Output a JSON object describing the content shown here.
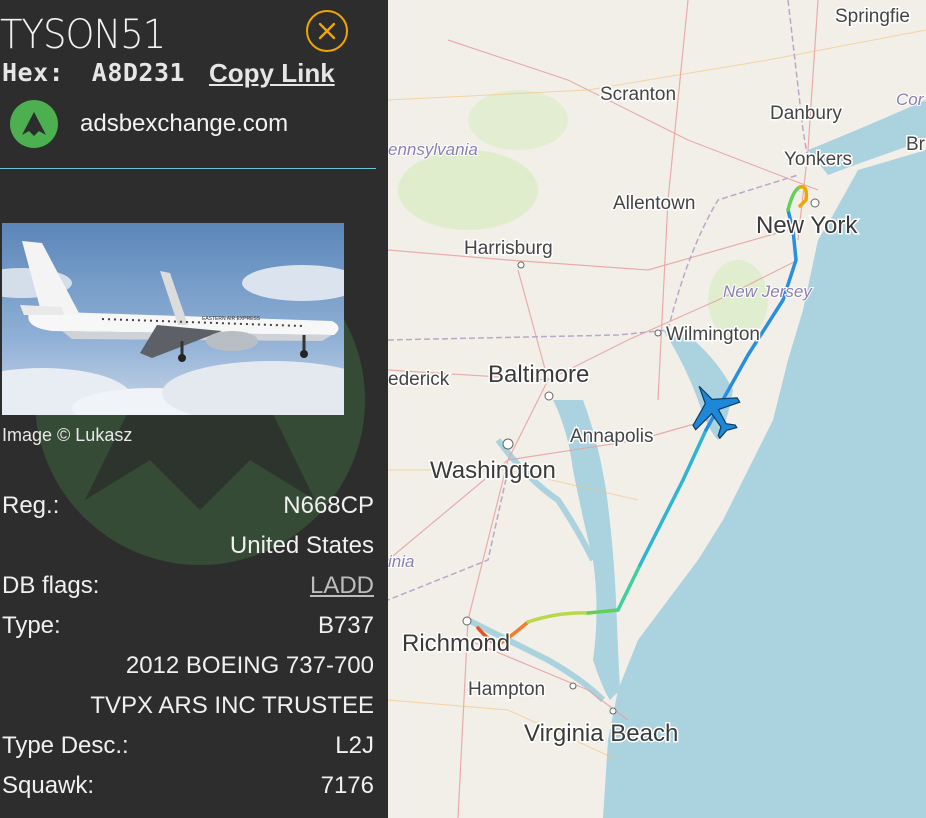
{
  "aircraft": {
    "callsign": "TYSON51",
    "hex_label": "Hex:",
    "hex_value": "A8D231",
    "copy_link": "Copy Link"
  },
  "source": {
    "site": "adsbexchange.com"
  },
  "photo": {
    "credit": "Image © Lukasz",
    "livery_text": "EASTERN AIR EXPRESS"
  },
  "details": [
    {
      "label": "Reg.:",
      "value": "N668CP"
    },
    {
      "label": "",
      "value": "United States"
    },
    {
      "label": "DB flags:",
      "value": "LADD",
      "link": true
    },
    {
      "label": "Type:",
      "value": "B737"
    },
    {
      "label": "",
      "value": "2012 BOEING 737-700"
    },
    {
      "label": "",
      "value": "TVPX ARS INC TRUSTEE"
    },
    {
      "label": "Type Desc.:",
      "value": "L2J"
    },
    {
      "label": "Squawk:",
      "value": "7176"
    }
  ],
  "map": {
    "cities": [
      "Springfield",
      "Scranton",
      "Danbury",
      "Yonkers",
      "Allentown",
      "New York",
      "Harrisburg",
      "Wilmington",
      "Baltimore",
      "Frederick",
      "Annapolis",
      "Washington",
      "Richmond",
      "Hampton",
      "Virginia Beach"
    ],
    "city_fragments": {
      "springfield": "Springfie",
      "frederick": "ederick",
      "bridgeport": "Br",
      "connecticut": "Cor",
      "virginia": "inia"
    },
    "states": [
      "Pennsylvania",
      "New Jersey"
    ],
    "state_fragments": {
      "pennsylvania": "ennsylvania"
    },
    "colors": {
      "water": "#aad3df",
      "land": "#f2efe9",
      "track_low": "#e8522a",
      "track_mid": "#5fd15a",
      "track_high": "#2a8ee0",
      "plane": "#1e88d8",
      "accent": "#f0a500"
    }
  }
}
